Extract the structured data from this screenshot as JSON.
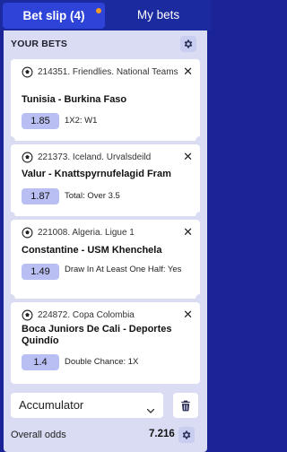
{
  "tabs": {
    "bet_slip": "Bet slip (4)",
    "my_bets": "My bets"
  },
  "header": {
    "title": "YOUR BETS",
    "settings_icon": "gear-icon"
  },
  "bets": [
    {
      "league": "214351. Friendlies. National Teams",
      "match": "Tunisia - Burkina Faso",
      "odds": "1.85",
      "selection": "1X2: W1"
    },
    {
      "league": "221373. Iceland. Urvalsdeild",
      "match": "Valur - Knattspyrnufelagid Fram",
      "odds": "1.87",
      "selection": "Total: Over 3.5"
    },
    {
      "league": "221008. Algeria. Ligue 1",
      "match": "Constantine - USM Khenchela",
      "odds": "1.49",
      "selection": "Draw In At Least One Half: Yes"
    },
    {
      "league": "224872. Copa Colombia",
      "match": "Boca Juniors De Cali - Deportes Quindío",
      "odds": "1.4",
      "selection": "Double Chance: 1X"
    }
  ],
  "footer": {
    "bet_type": "Accumulator",
    "overall_label": "Overall odds",
    "overall_value": "7.216"
  },
  "colors": {
    "brand_blue": "#1b2a9e",
    "active_tab": "#2e44d8",
    "notification_dot": "#f59a23",
    "odds_pill": "#b9bff2",
    "panel_bg": "#d9dcf3"
  }
}
